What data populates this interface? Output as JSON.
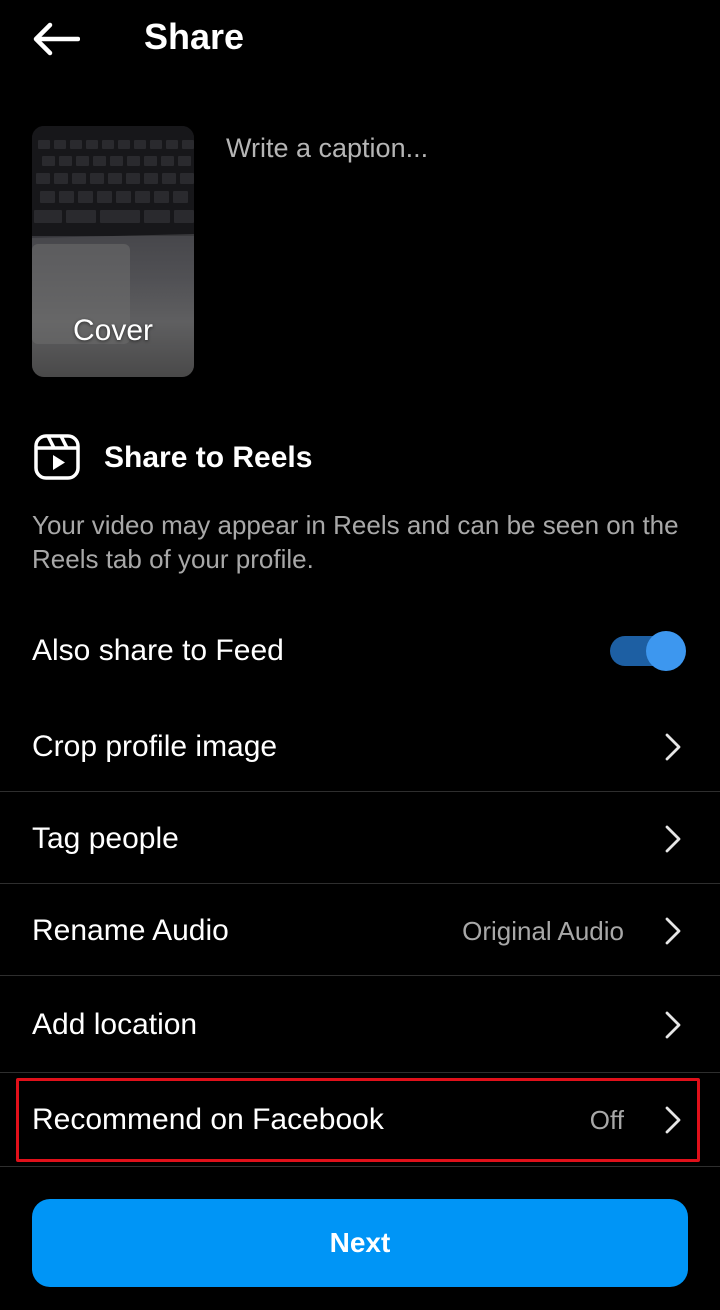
{
  "header": {
    "title": "Share",
    "back_icon": "arrow-left-icon"
  },
  "cover": {
    "label": "Cover"
  },
  "caption": {
    "placeholder": "Write a caption..."
  },
  "reels": {
    "icon": "reels-icon",
    "title": "Share to Reels",
    "description": "Your video may appear in Reels and can be seen on the Reels tab of your profile."
  },
  "options": {
    "also_share_to_feed": {
      "label": "Also share to Feed",
      "enabled": true
    },
    "crop_profile_image": {
      "label": "Crop profile image"
    },
    "tag_people": {
      "label": "Tag people"
    },
    "rename_audio": {
      "label": "Rename Audio",
      "value": "Original Audio"
    },
    "add_location": {
      "label": "Add location"
    },
    "recommend_on_facebook": {
      "label": "Recommend on Facebook",
      "value": "Off"
    }
  },
  "next_button": {
    "label": "Next"
  },
  "colors": {
    "background": "#000000",
    "primary": "#0095f6",
    "toggle_on": "#3d97ef",
    "highlight_border": "#e0101a",
    "secondary_text": "#a8a8a8"
  }
}
